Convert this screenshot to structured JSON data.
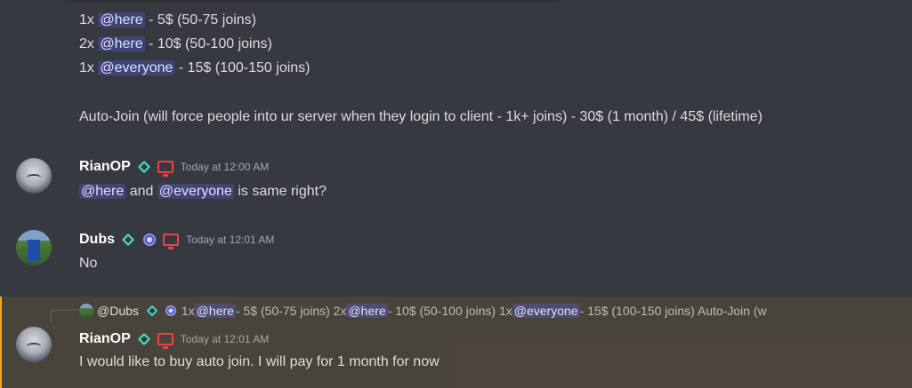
{
  "earlier_message": {
    "lines": [
      {
        "prefix": "1x ",
        "mention": "@here",
        "suffix": " - 5$ (50-75 joins)"
      },
      {
        "prefix": "2x ",
        "mention": "@here",
        "suffix": " - 10$ (50-100 joins)"
      },
      {
        "prefix": "1x ",
        "mention": "@everyone",
        "suffix": " - 15$ (100-150 joins)"
      }
    ],
    "autojoin": "Auto-Join (will force people into ur server when they login to client - 1k+ joins) - 30$ (1 month)  / 45$ (lifetime)"
  },
  "messages": [
    {
      "username": "RianOP",
      "timestamp": "Today at 12:00 AM",
      "mention1": "@here",
      "mid": " and ",
      "mention2": "@everyone",
      "suffix": " is same right?"
    },
    {
      "username": "Dubs",
      "timestamp": "Today at 12:01 AM",
      "text": "No"
    },
    {
      "username": "RianOP",
      "timestamp": "Today at 12:01 AM",
      "text": "I would like to buy auto join. I will pay for 1 month for now"
    }
  ],
  "reply_preview": {
    "author": "@Dubs",
    "t1": "1x ",
    "m1": "@here",
    "t2": " - 5$ (50-75 joins) 2x ",
    "m2": "@here",
    "t3": " - 10$ (50-100 joins) 1x ",
    "m3": "@everyone",
    "t4": " - 15$ (100-150 joins)  Auto-Join (w"
  },
  "colors": {
    "background": "#36393f",
    "mention_bg": "rgba(88,101,242,0.3)",
    "highlight": "#faa81a",
    "badge": "#45ddc0",
    "desktop_icon": "#ed4245"
  },
  "icons": [
    "badge-icon",
    "desktop-icon",
    "boost-icon"
  ]
}
